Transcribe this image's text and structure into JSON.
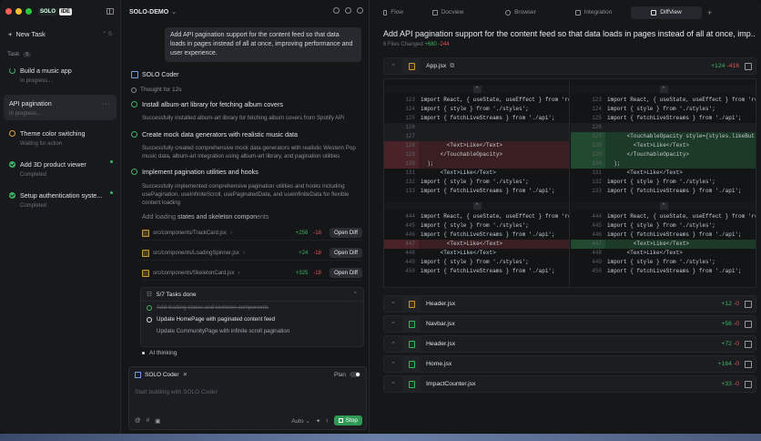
{
  "sidebar": {
    "logo": {
      "text": "SOLO",
      "badge": "IDE"
    },
    "new_task": {
      "label": "New Task",
      "shortcut": "⌃ S"
    },
    "section": {
      "label": "Task",
      "count": "5"
    },
    "tasks": [
      {
        "title": "Build a music app",
        "status": "In progress..."
      },
      {
        "title": "API pagination",
        "status": "In progress..."
      },
      {
        "title": "Theme color switching",
        "status": "Waiting for action"
      },
      {
        "title": "Add 3D product viewer",
        "status": "Completed"
      },
      {
        "title": "Setup authentication syste...",
        "status": "Completed"
      }
    ]
  },
  "chat": {
    "project": "SOLO-DEMO",
    "user_message": "Add API pagination support for the content feed so that data loads in pages instead of all at once, improving performance and user experience.",
    "agent_name": "SOLO Coder",
    "thought": "Thought for 12s",
    "steps": [
      {
        "title": "Install album-art library for fetching album covers",
        "desc": "Successfully installed album-art library for fetching album covers from Spotify API"
      },
      {
        "title": "Create mock data generators with realistic music data",
        "desc": "Successfully created comprehensive mock data generators with realistic Western Pop music data, album-art integration using album-art library, and pagination utilities"
      },
      {
        "title": "Implement pagination utilities and hooks",
        "desc": "Successfully implemented comprehensive pagination utilities and hooks including usePagination, useInfiniteScroll, usePaginatedData, and useInfiniteData for flexible content loading"
      }
    ],
    "loading_line": {
      "prefix": "Add loading",
      "strong": "states and skeleton compon",
      "suffix": "ents"
    },
    "files": [
      {
        "path": "src/components/TrackCard.jsx",
        "add": "+256",
        "del": "-18"
      },
      {
        "path": "src/components/LoadingSpinner.jsx",
        "add": "+24",
        "del": "-18"
      },
      {
        "path": "src/components/SkeletonCard.jsx",
        "add": "+325",
        "del": "-18"
      }
    ],
    "open_diff_label": "Open Diff",
    "tasks_done": "5/7  Tasks done",
    "todo": [
      {
        "text": "Add loading states and skeleton components",
        "state": "done"
      },
      {
        "text": "Update HomePage with paginated content feed",
        "state": "current"
      },
      {
        "text": "Update CommunityPage with infinite scroll pagination",
        "state": "pending"
      }
    ],
    "thinking": "AI thinking",
    "input": {
      "agent": "SOLO Coder",
      "plan_label": "Plan",
      "placeholder": "Start building with SOLO Coder",
      "mode": "Auto",
      "stop_label": "Stop"
    }
  },
  "tabs": [
    {
      "label": "Flow",
      "active": false
    },
    {
      "label": "Docview",
      "active": false
    },
    {
      "label": "Browser",
      "active": false
    },
    {
      "label": "Integration",
      "active": false
    },
    {
      "label": "DiffView",
      "active": true
    }
  ],
  "diff": {
    "title": "Add API pagination support for the content feed so that data loads in pages instead of all at once, imp...",
    "files_changed": "6 Files Changed",
    "total_add": "+680",
    "total_del": "-244",
    "main_file": {
      "name": "App.jsx",
      "add": "+124",
      "del": "-416"
    },
    "left_lines": [
      {
        "n": "123",
        "t": "import React, { useState, useEffect } from 're"
      },
      {
        "n": "124",
        "t": "import { style } from './styles';"
      },
      {
        "n": "125",
        "t": "import { fetchLiveStreams } from './api';"
      },
      {
        "n": "126",
        "t": ""
      },
      {
        "n": "127",
        "t": ""
      },
      {
        "n": "128",
        "t": "        <Text>Like</Text>"
      },
      {
        "n": "129",
        "t": "      </TouchableOpacity>"
      },
      {
        "n": "130",
        "t": "  );"
      },
      {
        "n": "131",
        "t": "      <Text>Like</Text>"
      },
      {
        "n": "132",
        "t": "import { style } from './styles';"
      },
      {
        "n": "133",
        "t": "import { fetchLiveStreams } from './api';"
      },
      {
        "n": "444",
        "t": "import React, { useState, useEffect } from 're"
      },
      {
        "n": "445",
        "t": "import { style } from './styles';"
      },
      {
        "n": "446",
        "t": "import { fetchLiveStreams } from './api';"
      },
      {
        "n": "447",
        "t": "        <Text>Like</Text>"
      },
      {
        "n": "448",
        "t": "      <Text>Like</Text>"
      },
      {
        "n": "449",
        "t": "import { style } from './styles';"
      },
      {
        "n": "450",
        "t": "import { fetchLiveStreams } from './api';"
      }
    ],
    "right_lines": [
      {
        "n": "123",
        "t": "import React, { useState, useEffect } from 're"
      },
      {
        "n": "124",
        "t": "import { style } from './styles';"
      },
      {
        "n": "125",
        "t": "import { fetchLiveStreams } from './api';"
      },
      {
        "n": "126",
        "t": ""
      },
      {
        "n": "127",
        "t": "      <TouchableOpacity style={styles.likeBut"
      },
      {
        "n": "128",
        "t": "        <Text>Like</Text>"
      },
      {
        "n": "129",
        "t": "      </TouchableOpacity>"
      },
      {
        "n": "130",
        "t": "  );"
      },
      {
        "n": "131",
        "t": "      <Text>Like</Text>"
      },
      {
        "n": "132",
        "t": "import { style } from './styles';"
      },
      {
        "n": "133",
        "t": "import { fetchLiveStreams } from './api';"
      },
      {
        "n": "444",
        "t": "import React, { useState, useEffect } from 're"
      },
      {
        "n": "445",
        "t": "import { style } from './styles';"
      },
      {
        "n": "446",
        "t": "import { fetchLiveStreams } from './api';"
      },
      {
        "n": "447",
        "t": "        <Text>Like</Text>"
      },
      {
        "n": "448",
        "t": "      <Text>Like</Text>"
      },
      {
        "n": "449",
        "t": "import { style } from './styles';"
      },
      {
        "n": "450",
        "t": "import { fetchLiveStreams } from './api';"
      }
    ],
    "other_files": [
      {
        "name": "Header.jsx",
        "add": "+12",
        "del": "-0"
      },
      {
        "name": "Navbar.jsx",
        "add": "+56",
        "del": "-0"
      },
      {
        "name": "Header.jsx",
        "add": "+72",
        "del": "-0"
      },
      {
        "name": "Home.jsx",
        "add": "+164",
        "del": "-0"
      },
      {
        "name": "ImpactCounter.jsx",
        "add": "+33",
        "del": "-0"
      }
    ]
  }
}
